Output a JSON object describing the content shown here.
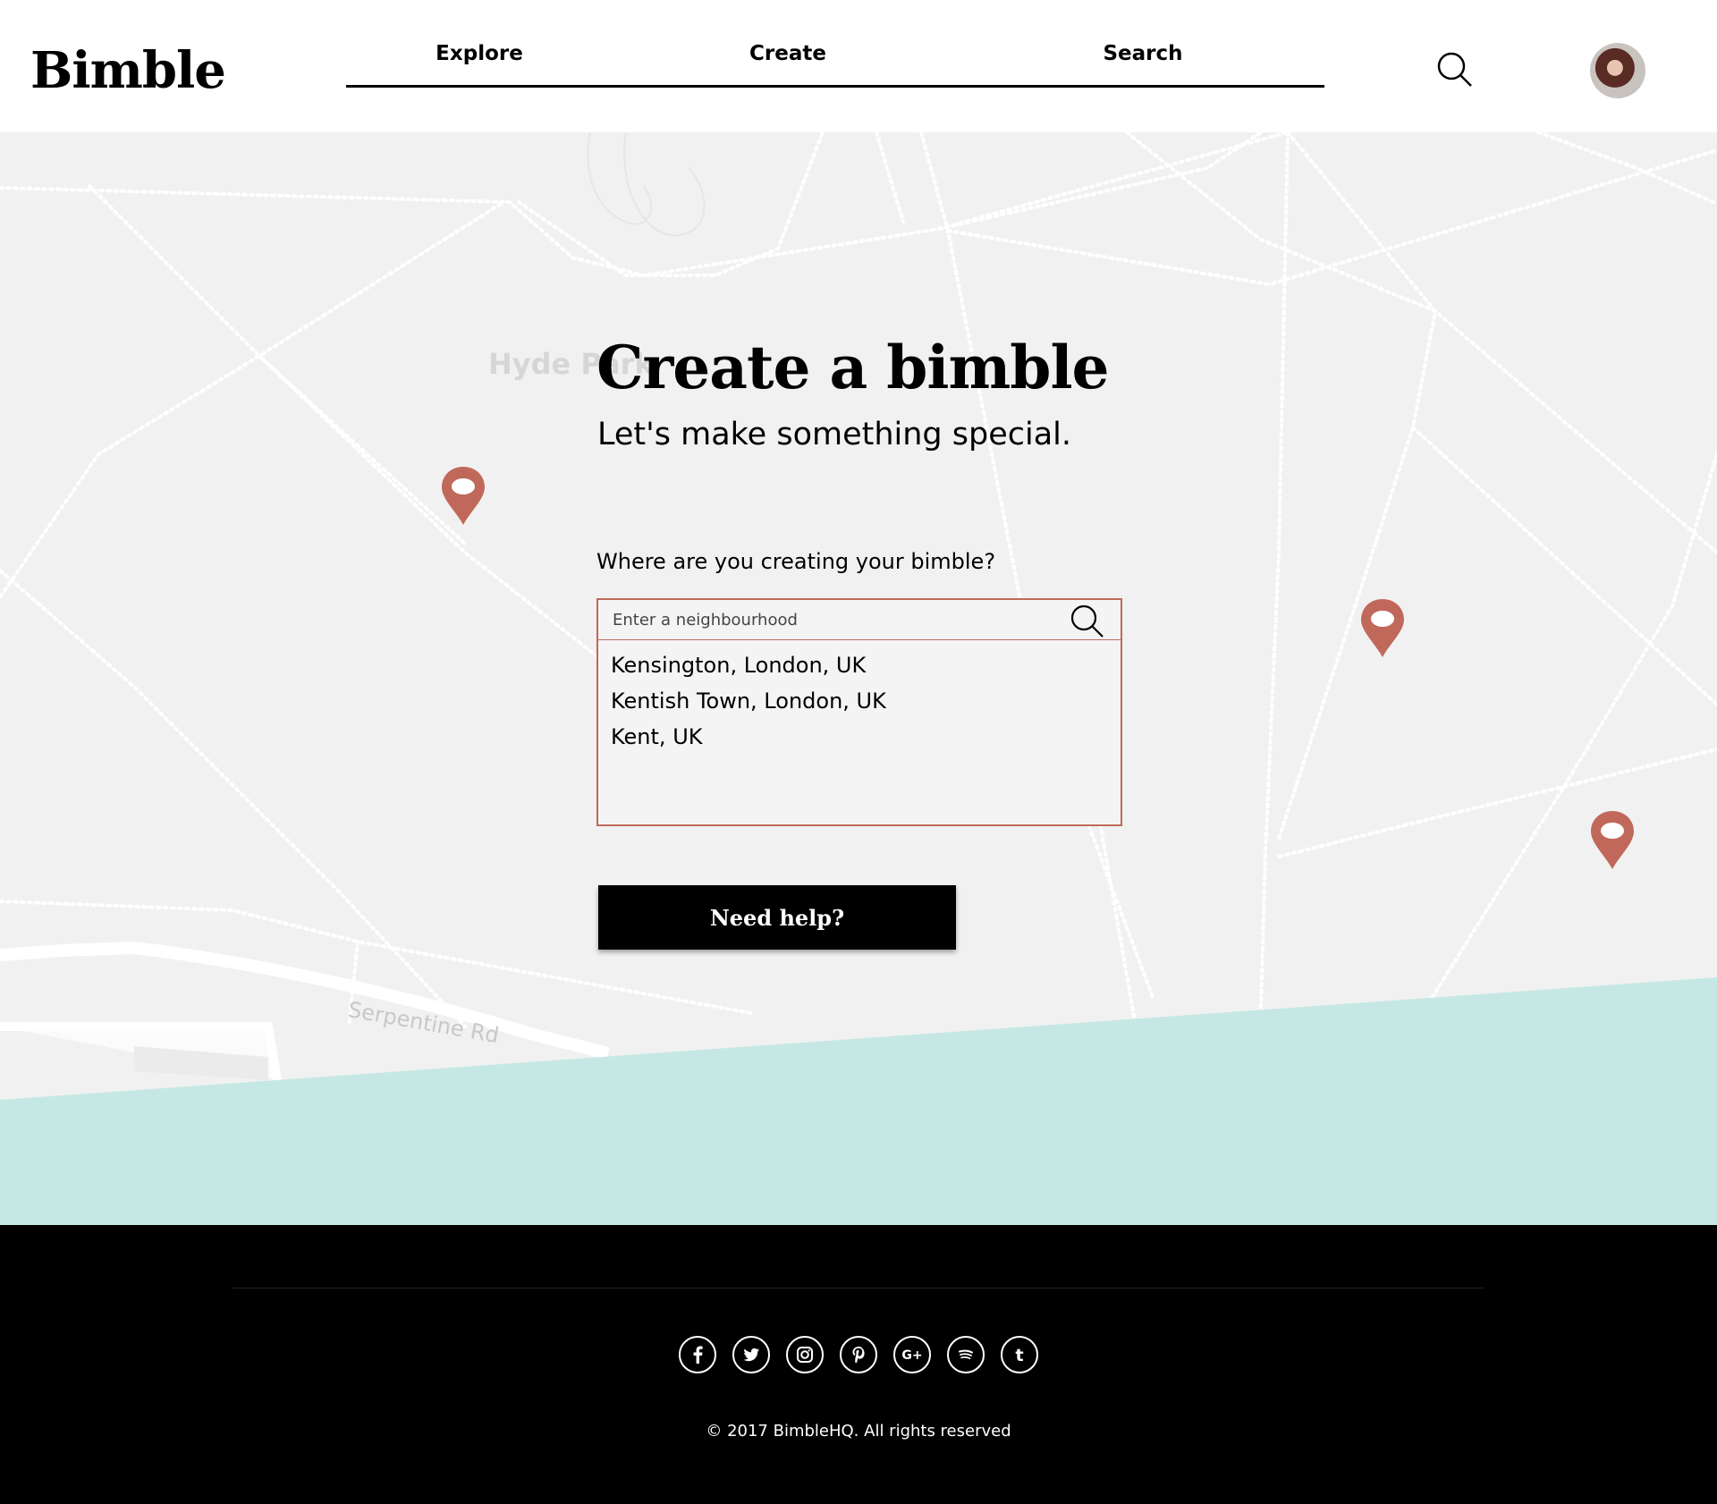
{
  "header": {
    "logo": "Bimble",
    "nav": [
      {
        "label": "Explore"
      },
      {
        "label": "Create"
      },
      {
        "label": "Search"
      }
    ]
  },
  "map": {
    "labels": {
      "park": "Hyde Park",
      "road": "Serpentine Rd"
    },
    "water_color": "#c5e8e4",
    "pin_color": "#c0685a"
  },
  "main": {
    "title": "Create a bimble",
    "subtitle": "Let's make something special.",
    "question": "Where are you creating your bimble?",
    "search": {
      "placeholder": "Enter a neighbourhood",
      "value": ""
    },
    "suggestions": [
      "Kensington, London, UK",
      "Kentish Town, London, UK",
      "Kent, UK"
    ],
    "help_button": "Need help?"
  },
  "footer": {
    "social_icons": [
      "facebook-icon",
      "twitter-icon",
      "instagram-icon",
      "pinterest-icon",
      "google-plus-icon",
      "spotify-icon",
      "tumblr-icon"
    ],
    "copyright": "© 2017 BimbleHQ. All rights reserved"
  }
}
